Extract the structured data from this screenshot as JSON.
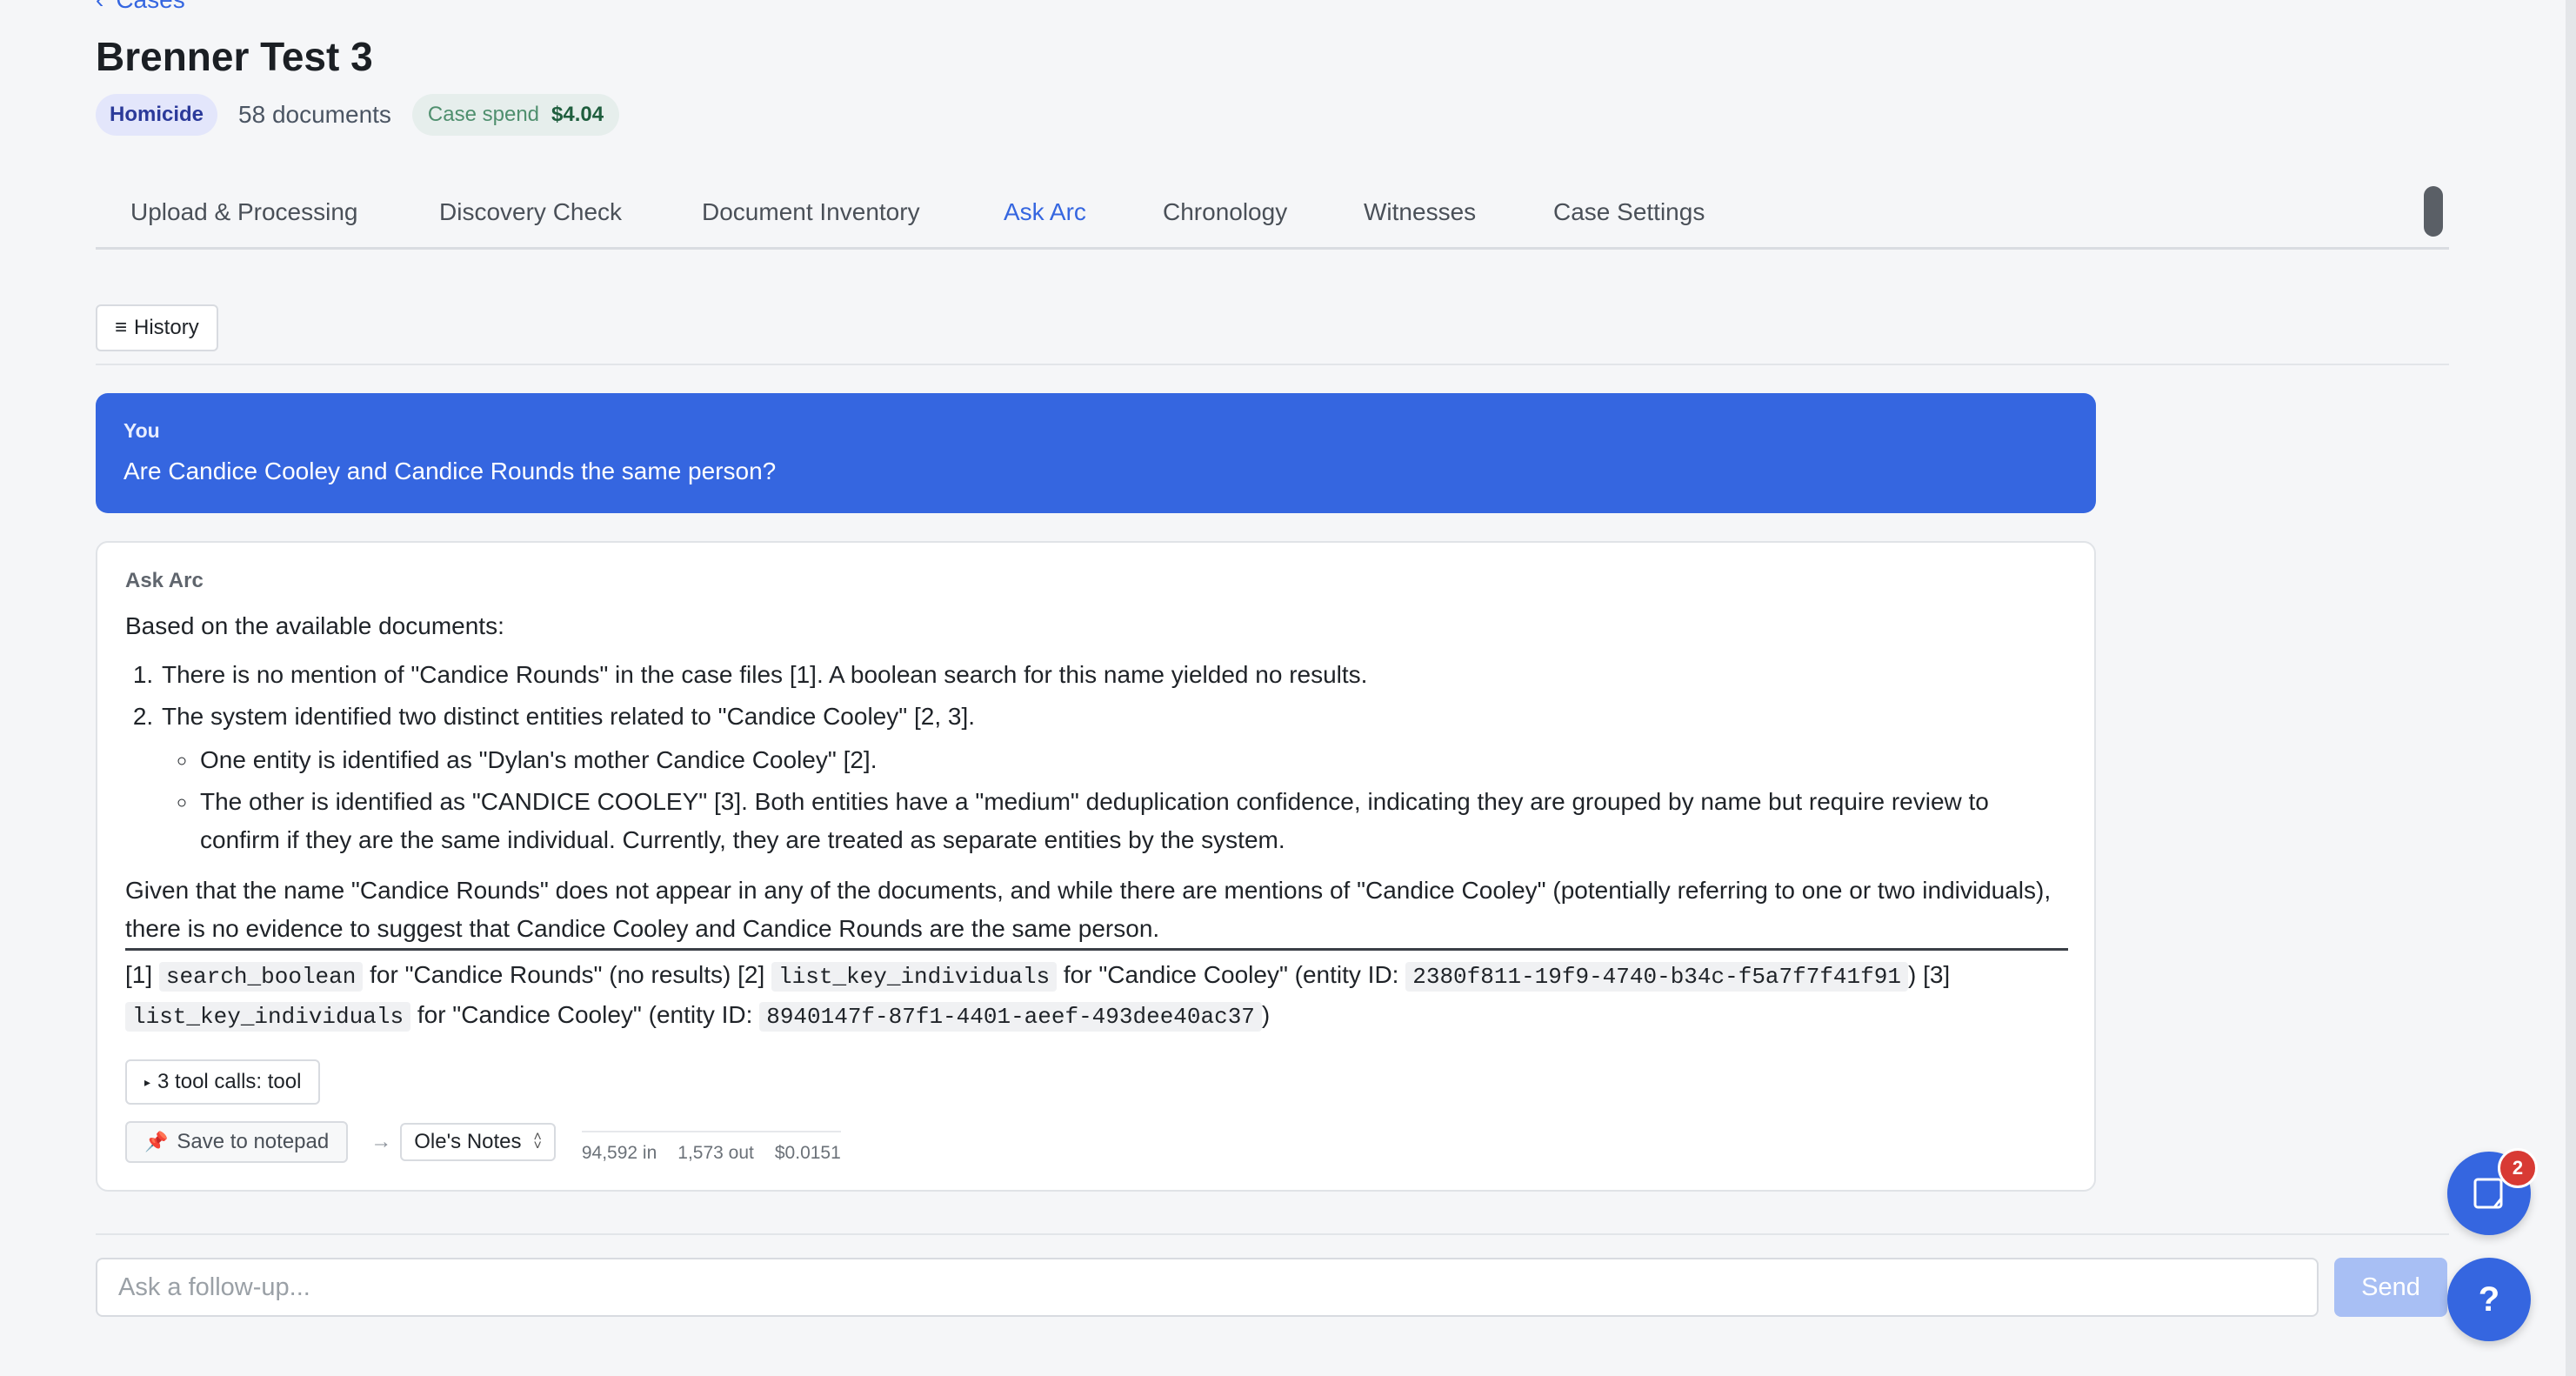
{
  "nav": {
    "back_label": "Cases"
  },
  "case": {
    "title": "Brenner Test 3",
    "category": "Homicide",
    "documents": "58 documents",
    "spend_label": "Case spend",
    "spend_value": "$4.04"
  },
  "tabs": [
    {
      "label": "Upload & Processing",
      "active": false
    },
    {
      "label": "Discovery Check",
      "active": false
    },
    {
      "label": "Document Inventory",
      "active": false
    },
    {
      "label": "Ask Arc",
      "active": true
    },
    {
      "label": "Chronology",
      "active": false
    },
    {
      "label": "Witnesses",
      "active": false
    },
    {
      "label": "Case Settings",
      "active": false
    }
  ],
  "history_label": "History",
  "user_message": {
    "sender": "You",
    "text": "Are Candice Cooley and Candice Rounds the same person?"
  },
  "answer": {
    "sender": "Ask Arc",
    "intro": "Based on the available documents:",
    "items": [
      "There is no mention of \"Candice Rounds\" in the case files [1]. A boolean search for this name yielded no results.",
      "The system identified two distinct entities related to \"Candice Cooley\" [2, 3]."
    ],
    "subitems": [
      "One entity is identified as \"Dylan's mother Candice Cooley\" [2].",
      "The other is identified as \"CANDICE COOLEY\" [3]. Both entities have a \"medium\" deduplication confidence, indicating they are grouped by name but require review to confirm if they are the same individual. Currently, they are treated as separate entities by the system."
    ],
    "conclusion": "Given that the name \"Candice Rounds\" does not appear in any of the documents, and while there are mentions of \"Candice Cooley\" (potentially referring to one or two individuals), there is no evidence to suggest that Candice Cooley and Candice Rounds are the same person.",
    "refs": {
      "r1_marker": "[1]",
      "r1_code": "search_boolean",
      "r1_text": "for \"Candice Rounds\" (no results)",
      "r2_marker": "[2]",
      "r2_code": "list_key_individuals",
      "r2_text": "for \"Candice Cooley\" (entity ID:",
      "r2_id": "2380f811-19f9-4740-b34c-f5a7f7f41f91",
      "r2_close": ")",
      "r3_marker": "[3]",
      "r3_code": "list_key_individuals",
      "r3_text": "for \"Candice Cooley\" (entity ID:",
      "r3_id": "8940147f-87f1-4401-aeef-493dee40ac37",
      "r3_close": ")"
    },
    "tool_calls_label": "3 tool calls: tool",
    "save_label": "Save to notepad",
    "notepad_selected": "Ole's Notes",
    "usage": {
      "tokens_in": "94,592 in",
      "tokens_out": "1,573 out",
      "cost": "$0.0151"
    }
  },
  "composer": {
    "placeholder": "Ask a follow-up...",
    "send_label": "Send"
  },
  "notes_badge": "2",
  "help_label": "?",
  "colors": {
    "accent": "#3566e0",
    "badge": "#d83a34"
  }
}
